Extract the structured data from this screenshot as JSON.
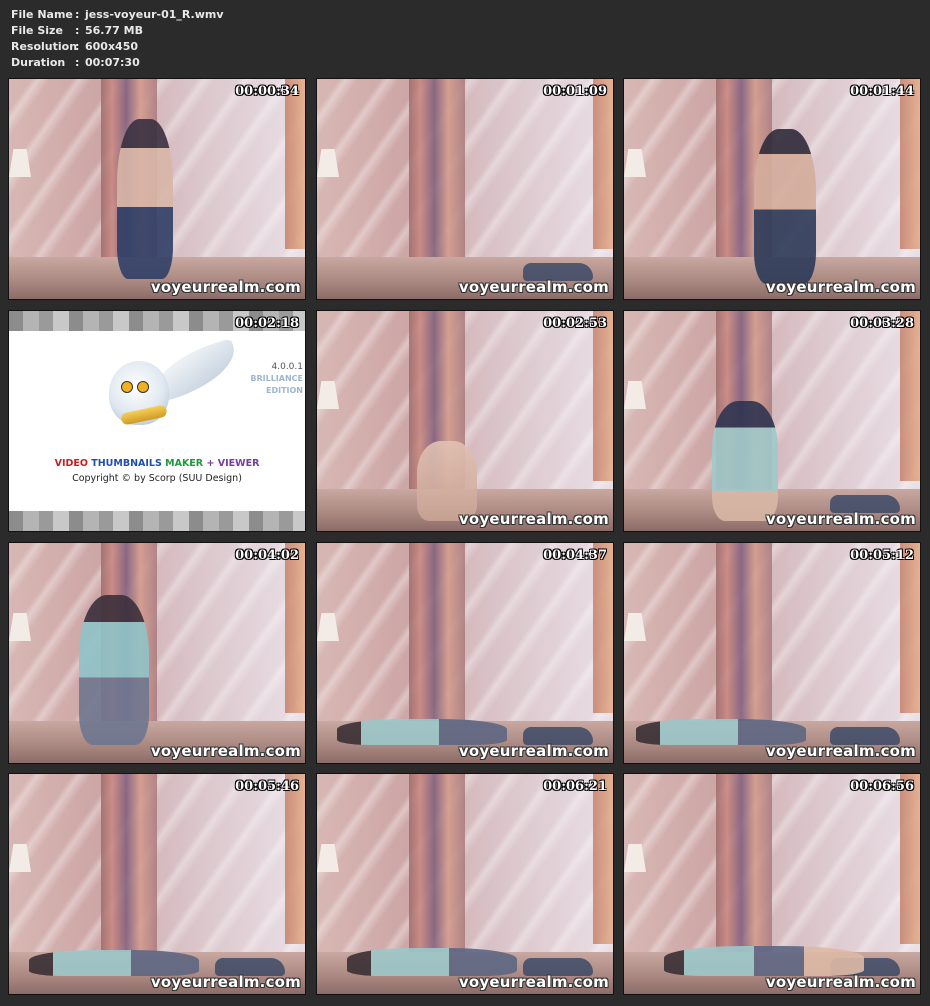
{
  "info": {
    "rows": [
      {
        "label": "File Name",
        "value": "jess-voyeur-01_R.wmv"
      },
      {
        "label": "File Size",
        "value": "56.77 MB"
      },
      {
        "label": "Resolution",
        "value": "600x450"
      },
      {
        "label": "Duration",
        "value": "00:07:30"
      }
    ],
    "separator": ":"
  },
  "watermark": "voyeurrealm.com",
  "thumbnails": [
    {
      "timecode": "00:00:34"
    },
    {
      "timecode": "00:01:09"
    },
    {
      "timecode": "00:01:44"
    },
    {
      "timecode": "00:02:18"
    },
    {
      "timecode": "00:02:53"
    },
    {
      "timecode": "00:03:28"
    },
    {
      "timecode": "00:04:02"
    },
    {
      "timecode": "00:04:37"
    },
    {
      "timecode": "00:05:12"
    },
    {
      "timecode": "00:05:46"
    },
    {
      "timecode": "00:06:21"
    },
    {
      "timecode": "00:06:56"
    }
  ],
  "logo": {
    "version": "4.0.0.1",
    "edition_line1": "BRILLIANCE",
    "edition_line2": "EDITION",
    "title_part1": "VIDEO",
    "title_part2": "THUMBNAILS",
    "title_part3": "MAKER",
    "title_plus": "+",
    "title_part4": "VIEWER",
    "copyright": "Copyright © by Scorp (SUU Design)"
  }
}
